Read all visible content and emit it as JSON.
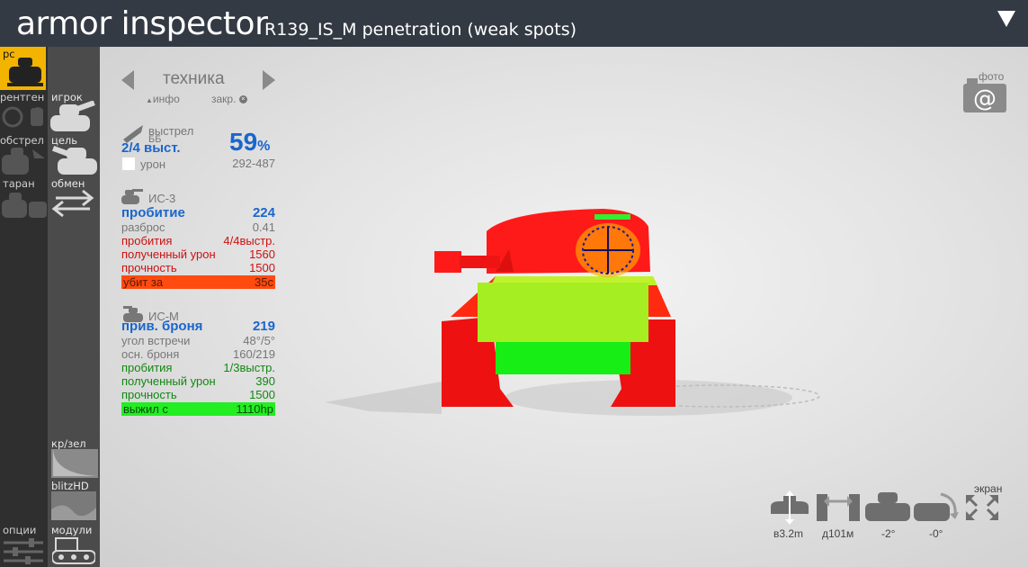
{
  "header": {
    "title": "armor inspector",
    "vehicle_code": "R139_IS_M",
    "mode": "penetration (weak spots)"
  },
  "colors": {
    "header_bg": "#343a44",
    "accent_yellow": "#f2b400",
    "blue_text": "#1a66cc",
    "killed_bar": "#ff4a10",
    "survived_bar": "#22ee22"
  },
  "sidebar": {
    "col1": {
      "ps": "рс",
      "xray": "рентген",
      "shelling": "обстрел",
      "ram": "таран",
      "options": "опции"
    },
    "col2": {
      "player": "игрок",
      "target": "цель",
      "swap": "обмен",
      "red_green": "кр/зел",
      "blitz_hd": "blitzHD",
      "modules": "модули"
    }
  },
  "vehicle_nav": {
    "label": "техника",
    "info": "инфо",
    "close": "закр."
  },
  "shot": {
    "label": "выстрел",
    "ammo": "ББ",
    "count": "2/4 выст.",
    "chance_value": "59",
    "chance_unit": "%",
    "damage_label": "урон",
    "damage_range": "292-487"
  },
  "attacker": {
    "name": "ИС-3",
    "penetration_label": "пробитие",
    "penetration_value": "224",
    "dispersion_label": "разброс",
    "dispersion_value": "0.41",
    "pens_label": "пробития",
    "pens_value": "4/4выстр.",
    "damage_taken_label": "полученный урон",
    "damage_taken_value": "1560",
    "hp_label": "прочность",
    "hp_value": "1500",
    "result_label": "убит за",
    "result_value": "35с"
  },
  "defender": {
    "name": "ИС-М",
    "eff_armor_label": "прив. броня",
    "eff_armor_value": "219",
    "angle_label": "угол встречи",
    "angle_value": "48°/5°",
    "base_armor_label": "осн. броня",
    "base_armor_value": "160/219",
    "pens_label": "пробития",
    "pens_value": "1/3выстр.",
    "damage_taken_label": "полученный урон",
    "damage_taken_value": "390",
    "hp_label": "прочность",
    "hp_value": "1500",
    "result_label": "выжил с",
    "result_value": "1110hp"
  },
  "photo": {
    "label": "фото"
  },
  "screen_label": "экран",
  "camera_controls": {
    "height": "в3.2m",
    "distance": "д101м",
    "pitch": "-2°",
    "yaw": "-0°"
  }
}
